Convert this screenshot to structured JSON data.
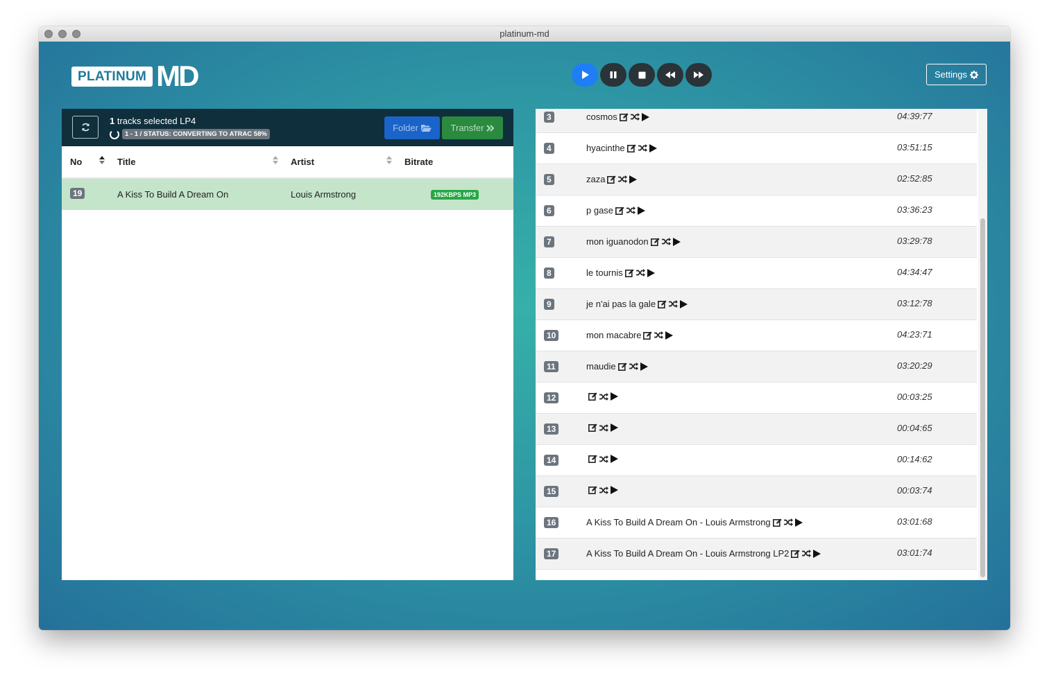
{
  "window": {
    "title": "platinum-md"
  },
  "logo": {
    "box_text": "PLATINUM",
    "md_text": "MD"
  },
  "header": {
    "settings_label": "Settings",
    "player_icons": [
      "play-icon",
      "pause-icon",
      "stop-icon",
      "rewind-icon",
      "fast-forward-icon"
    ]
  },
  "left_panel": {
    "selected_count": "1",
    "selected_text": " tracks selected LP4",
    "status": "1 - 1 / STATUS: CONVERTING TO ATRAC 58%",
    "folder_label": "Folder",
    "transfer_label": "Transfer",
    "columns": {
      "no": "No",
      "title": "Title",
      "artist": "Artist",
      "bitrate": "Bitrate"
    },
    "row": {
      "no": "19",
      "title": "A Kiss To Build A Dream On",
      "artist": "Louis Armstrong",
      "bitrate": "192KBPS MP3"
    }
  },
  "tracks": [
    {
      "no": "3",
      "title": "cosmos",
      "duration": "04:39:77"
    },
    {
      "no": "4",
      "title": "hyacinthe",
      "duration": "03:51:15"
    },
    {
      "no": "5",
      "title": "zaza",
      "duration": "02:52:85"
    },
    {
      "no": "6",
      "title": "p gase",
      "duration": "03:36:23"
    },
    {
      "no": "7",
      "title": "mon iguanodon",
      "duration": "03:29:78"
    },
    {
      "no": "8",
      "title": "le tournis",
      "duration": "04:34:47"
    },
    {
      "no": "9",
      "title": "je n'ai pas la gale",
      "duration": "03:12:78"
    },
    {
      "no": "10",
      "title": "mon macabre",
      "duration": "04:23:71"
    },
    {
      "no": "11",
      "title": "maudie",
      "duration": "03:20:29"
    },
    {
      "no": "12",
      "title": "",
      "duration": "00:03:25"
    },
    {
      "no": "13",
      "title": "",
      "duration": "00:04:65"
    },
    {
      "no": "14",
      "title": "",
      "duration": "00:14:62"
    },
    {
      "no": "15",
      "title": "",
      "duration": "00:03:74"
    },
    {
      "no": "16",
      "title": "A Kiss To Build A Dream On - Louis Armstrong",
      "duration": "03:01:68"
    },
    {
      "no": "17",
      "title": "A Kiss To Build A Dream On - Louis Armstrong LP2",
      "duration": "03:01:74"
    }
  ],
  "colors": {
    "play_button": "#1f7ef5",
    "folder_button": "#1a63c8",
    "transfer_button": "#2a8a3f",
    "selected_row": "#c4e5ca"
  }
}
